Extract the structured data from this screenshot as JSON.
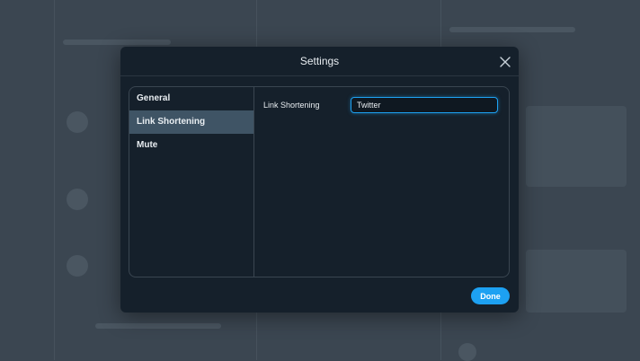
{
  "dialog": {
    "title": "Settings",
    "close_icon": "close-icon"
  },
  "sidebar": {
    "items": [
      {
        "label": "General",
        "active": false
      },
      {
        "label": "Link Shortening",
        "active": true
      },
      {
        "label": "Mute",
        "active": false
      }
    ]
  },
  "link_shortening": {
    "label": "Link Shortening",
    "value": "Twitter"
  },
  "footer": {
    "done_label": "Done"
  },
  "colors": {
    "accent": "#1da1f2",
    "modal_bg": "#15202b",
    "active_item_bg": "#3f5465"
  }
}
